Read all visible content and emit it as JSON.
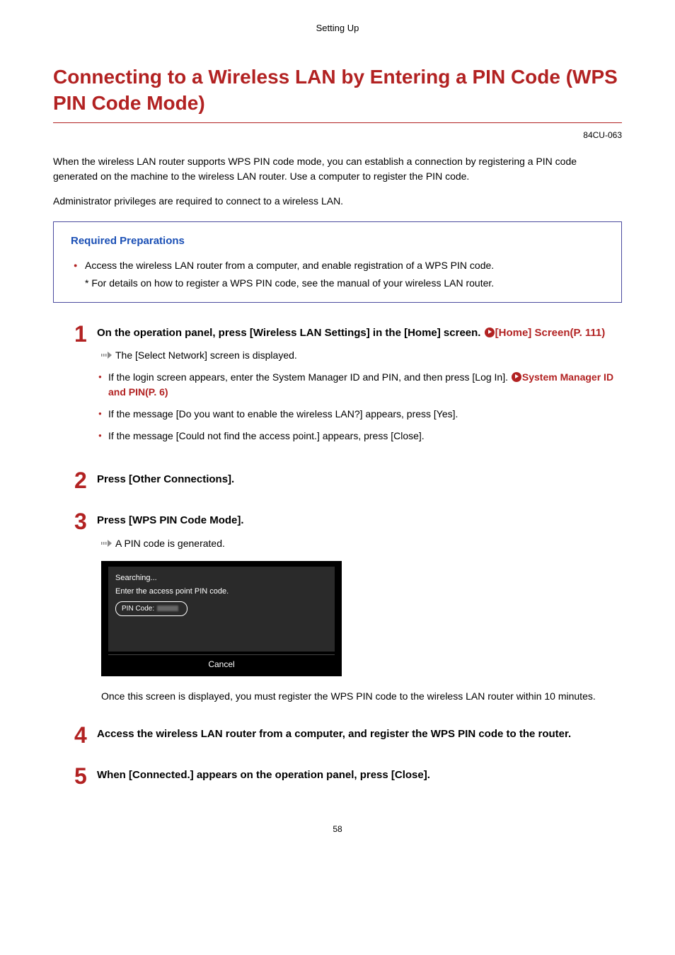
{
  "section_header": "Setting Up",
  "title": "Connecting to a Wireless LAN by Entering a PIN Code (WPS PIN Code Mode)",
  "doc_code": "84CU-063",
  "intro_p1": "When the wireless LAN router supports WPS PIN code mode, you can establish a connection by registering a PIN code generated on the machine to the wireless LAN router. Use a computer to register the PIN code.",
  "intro_p2": "Administrator privileges are required to connect to a wireless LAN.",
  "prep": {
    "title": "Required Preparations",
    "item1": "Access the wireless LAN router from a computer, and enable registration of a WPS PIN code.",
    "note": "* For details on how to register a WPS PIN code, see the manual of your wireless LAN router."
  },
  "steps": {
    "s1": {
      "num": "1",
      "heading_part1": "On the operation panel, press [Wireless LAN Settings] in the [Home] screen. ",
      "link1": "[Home] Screen(P. 111)",
      "result": "The [Select Network] screen is displayed.",
      "bullet1_part1": "If the login screen appears, enter the System Manager ID and PIN, and then press [Log In]. ",
      "bullet1_link": "System Manager ID and PIN(P. 6)",
      "bullet2": "If the message [Do you want to enable the wireless LAN?] appears, press [Yes].",
      "bullet3": "If the message [Could not find the access point.] appears, press [Close]."
    },
    "s2": {
      "num": "2",
      "heading": "Press [Other Connections]."
    },
    "s3": {
      "num": "3",
      "heading": "Press [WPS PIN Code Mode].",
      "result": "A PIN code is generated.",
      "screen": {
        "searching": "Searching...",
        "enter_msg": "Enter the access point PIN code.",
        "pin_label": "PIN Code:",
        "cancel": "Cancel"
      },
      "post_note": "Once this screen is displayed, you must register the WPS PIN code to the wireless LAN router within 10 minutes."
    },
    "s4": {
      "num": "4",
      "heading": "Access the wireless LAN router from a computer, and register the WPS PIN code to the router."
    },
    "s5": {
      "num": "5",
      "heading": "When [Connected.] appears on the operation panel, press [Close]."
    }
  },
  "page_number": "58"
}
